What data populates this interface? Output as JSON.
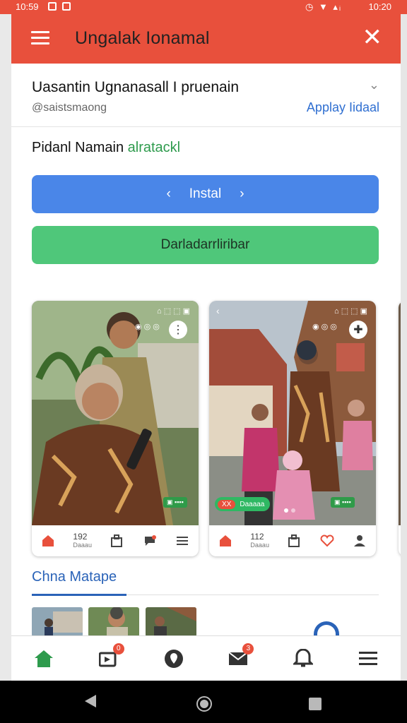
{
  "status": {
    "time_left": "10:59",
    "time_right": "10:20",
    "signal": "▲ᵢᵢ"
  },
  "appbar": {
    "title": "Ungalak Ionamal",
    "menu_icon": "hamburger-icon",
    "close_icon": "close-icon"
  },
  "profile": {
    "name": "Uasantin Ugnanasall I pruenain",
    "handle": "@saistsmaong",
    "apply_link": "Applay Iidaal",
    "expand_icon": "chevron-down-icon"
  },
  "status_line": {
    "label": "Pidanl Namain",
    "value": "alratackl"
  },
  "actions": {
    "install_label": "Instal",
    "download_label": "Darladarrliribar"
  },
  "cards": [
    {
      "count": "192",
      "sub": "Daaau",
      "icons": [
        "home-icon",
        "bag-icon",
        "comment-icon",
        "menu-icon"
      ]
    },
    {
      "count": "112",
      "sub": "Daaau",
      "icons": [
        "home-icon",
        "bag-icon",
        "heart-icon",
        "person-icon"
      ],
      "pill_red": "XX",
      "pill_label": "Daaaaa"
    }
  ],
  "section": {
    "title": "Chna Matape"
  },
  "tabs": [
    {
      "name": "home",
      "badge": ""
    },
    {
      "name": "videos",
      "badge": "0"
    },
    {
      "name": "location",
      "badge": ""
    },
    {
      "name": "messages",
      "badge": "3"
    },
    {
      "name": "notifications",
      "badge": ""
    },
    {
      "name": "menu",
      "badge": ""
    }
  ],
  "colors": {
    "accent": "#e8503c",
    "primary": "#4a86e8",
    "success": "#4fc77a",
    "link": "#2f6fd1"
  }
}
